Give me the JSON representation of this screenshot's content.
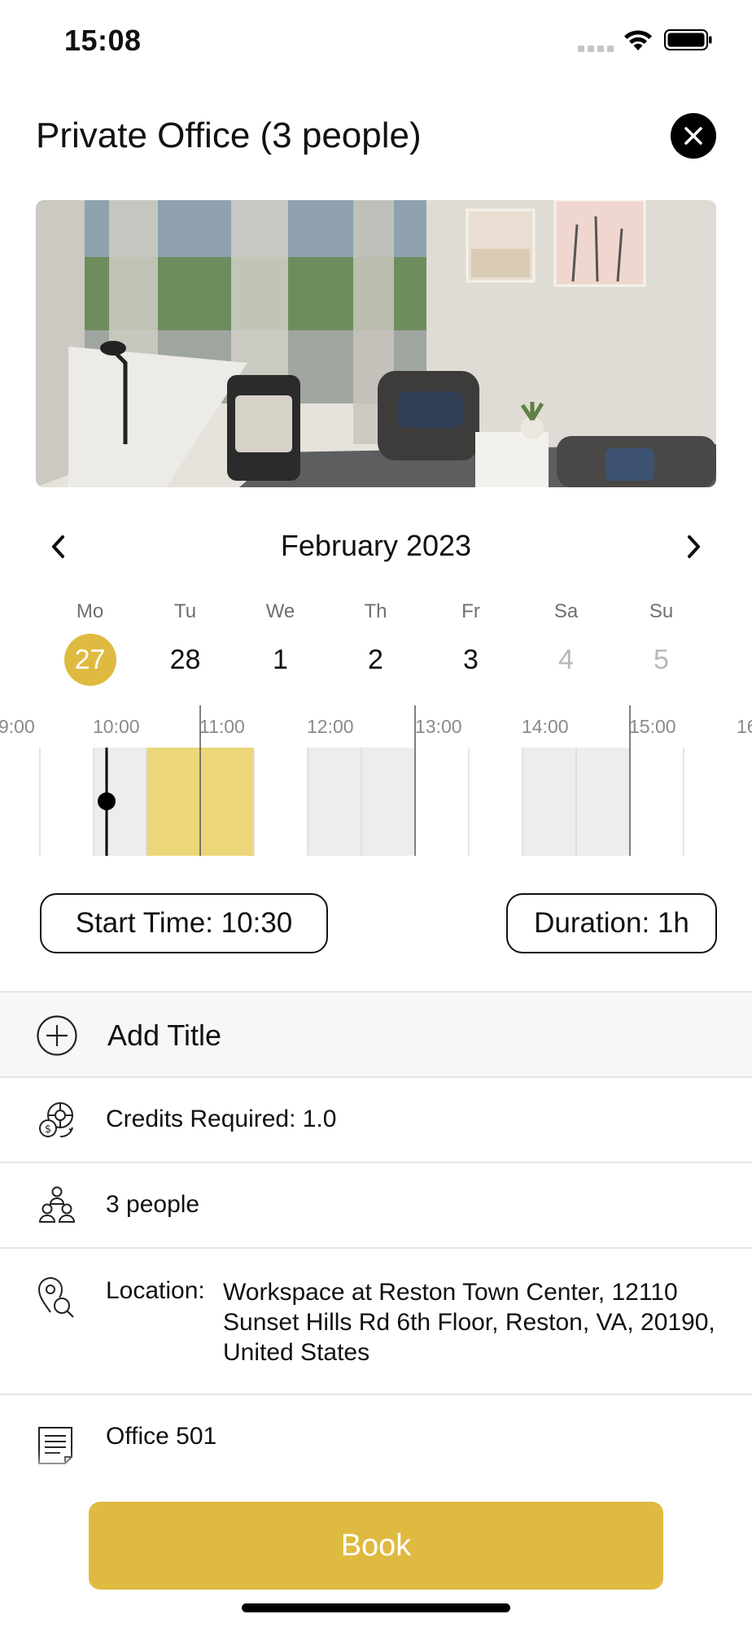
{
  "status_bar": {
    "time": "15:08"
  },
  "header": {
    "title": "Private Office (3 people)"
  },
  "calendar": {
    "month_label": "February 2023",
    "days": [
      {
        "name": "Mo",
        "number": "27",
        "state": "selected"
      },
      {
        "name": "Tu",
        "number": "28",
        "state": "normal"
      },
      {
        "name": "We",
        "number": "1",
        "state": "normal"
      },
      {
        "name": "Th",
        "number": "2",
        "state": "normal"
      },
      {
        "name": "Fr",
        "number": "3",
        "state": "normal"
      },
      {
        "name": "Sa",
        "number": "4",
        "state": "disabled"
      },
      {
        "name": "Su",
        "number": "5",
        "state": "disabled"
      }
    ]
  },
  "timeline": {
    "hour_labels": [
      "9:00",
      "10:00",
      "11:00",
      "12:00",
      "13:00",
      "14:00",
      "15:00",
      "16"
    ],
    "selected_start": "10:30",
    "selected_end": "11:30",
    "current_time": "10:05"
  },
  "controls": {
    "start_time_label": "Start Time: 10:30",
    "duration_label": "Duration: 1h"
  },
  "details": {
    "add_title_label": "Add Title",
    "credits_label": "Credits Required: 1.0",
    "people_label": "3 people",
    "location_label": "Location:",
    "location_value": "Workspace at Reston Town Center, 12110 Sunset Hills Rd 6th Floor, Reston, VA, 20190, United States",
    "office_label": "Office 501"
  },
  "book_button_label": "Book",
  "colors": {
    "accent": "#dfba40",
    "booked_block": "#ededed",
    "selection_block": "#ebd67a",
    "divider": "#e6e6e8"
  },
  "icons": {
    "close": "close-icon",
    "prev": "chevron-left-icon",
    "next": "chevron-right-icon",
    "add": "plus-circle-icon",
    "credits": "credits-icon",
    "people": "people-icon",
    "location": "location-icon",
    "office": "document-icon"
  }
}
